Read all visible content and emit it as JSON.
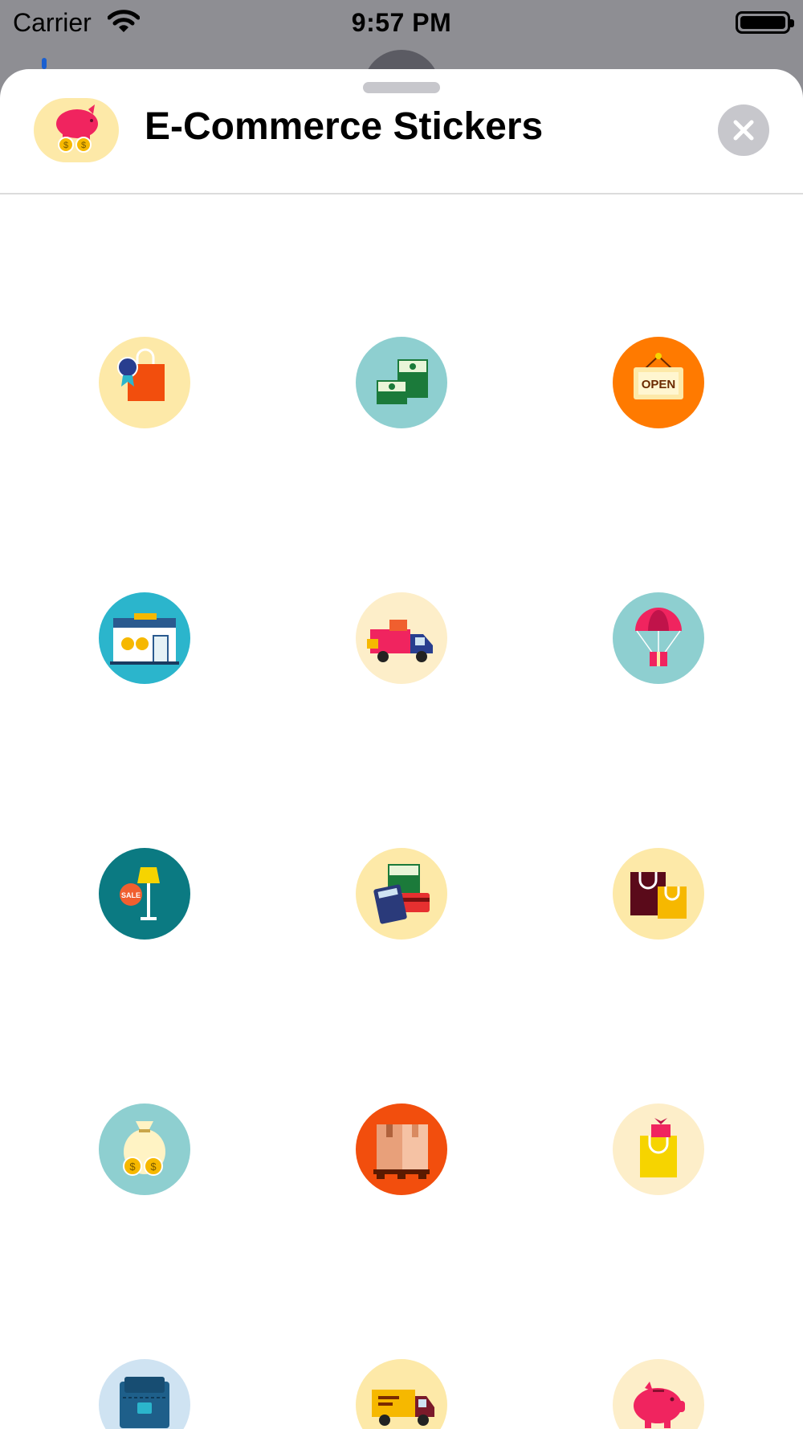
{
  "status_bar": {
    "carrier": "Carrier",
    "time": "9:57 PM"
  },
  "sheet": {
    "title": "E-Commerce Stickers",
    "app_icon": "piggy-bank-coins-icon",
    "close_icon": "close-x-icon"
  },
  "stickers": [
    {
      "name": "shopping-bag-award-icon",
      "bg": "#fde9a8"
    },
    {
      "name": "cash-stacks-icon",
      "bg": "#8ecfd0"
    },
    {
      "name": "open-sign-icon",
      "bg": "#ff7a00"
    },
    {
      "name": "storefront-icon",
      "bg": "#2bb5cc"
    },
    {
      "name": "delivery-truck-icon",
      "bg": "#fdeec9"
    },
    {
      "name": "parachute-gift-icon",
      "bg": "#8ecfd0"
    },
    {
      "name": "sale-lamp-icon",
      "bg": "#0b7a82"
    },
    {
      "name": "calculator-money-card-icon",
      "bg": "#fde9a8"
    },
    {
      "name": "shopping-bags-icon",
      "bg": "#fde9a8"
    },
    {
      "name": "money-bag-icon",
      "bg": "#8ecfd0"
    },
    {
      "name": "fragile-boxes-icon",
      "bg": "#f24e0d"
    },
    {
      "name": "gift-bag-icon",
      "bg": "#fdeec9"
    },
    {
      "name": "wallet-icon",
      "bg": "#cfe3f2"
    },
    {
      "name": "delivery-van-icon",
      "bg": "#fde9a8"
    },
    {
      "name": "piggy-bank-icon",
      "bg": "#fdeec9"
    }
  ]
}
